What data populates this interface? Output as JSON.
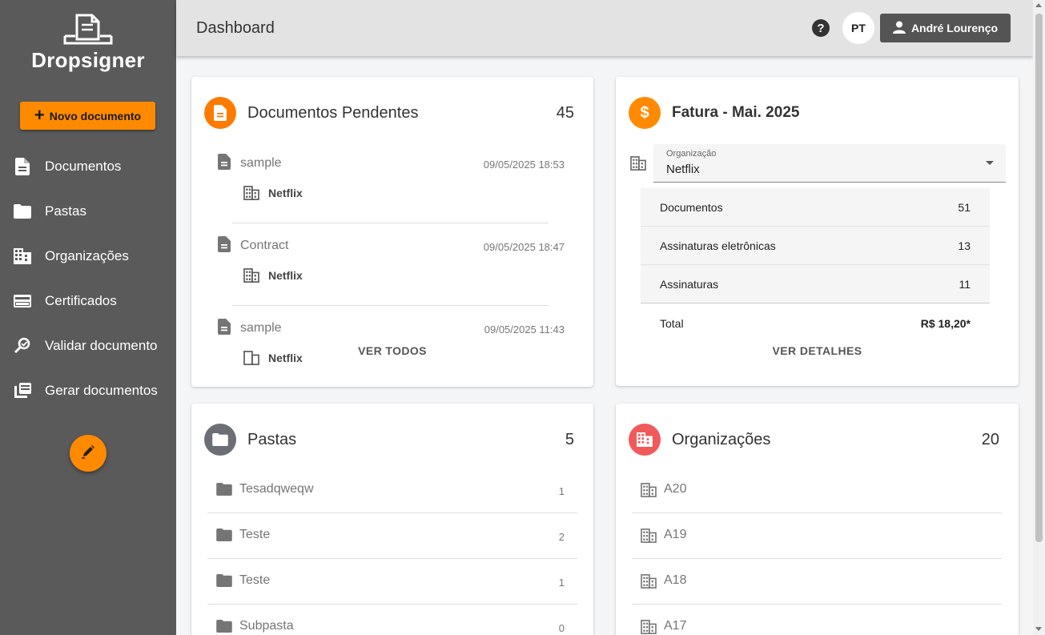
{
  "app": {
    "name": "Dropsigner"
  },
  "sidebar": {
    "new_document_label": "Novo documento",
    "items": [
      {
        "label": "Documentos",
        "icon": "document-icon"
      },
      {
        "label": "Pastas",
        "icon": "folder-icon"
      },
      {
        "label": "Organizações",
        "icon": "building-icon"
      },
      {
        "label": "Certificados",
        "icon": "credit-card-icon"
      },
      {
        "label": "Validar documento",
        "icon": "search-check-icon"
      },
      {
        "label": "Gerar documentos",
        "icon": "copy-icon"
      }
    ],
    "fab_icon": "pen-icon"
  },
  "header": {
    "title": "Dashboard",
    "language": "PT",
    "user_name": "André Lourenço"
  },
  "pending": {
    "title": "Documentos Pendentes",
    "count": "45",
    "items": [
      {
        "name": "sample",
        "date": "09/05/2025 18:53",
        "org": "Netflix"
      },
      {
        "name": "Contract",
        "date": "09/05/2025 18:47",
        "org": "Netflix"
      },
      {
        "name": "sample",
        "date": "09/05/2025 11:43",
        "org": "Netflix"
      }
    ],
    "view_all": "VER TODOS"
  },
  "invoice": {
    "title": "Fatura - Mai. 2025",
    "org_label": "Organização",
    "org_value": "Netflix",
    "rows": [
      {
        "label": "Documentos",
        "value": "51"
      },
      {
        "label": "Assinaturas eletrônicas",
        "value": "13"
      },
      {
        "label": "Assinaturas",
        "value": "11"
      }
    ],
    "total_label": "Total",
    "total_value": "R$ 18,20*",
    "details": "VER DETALHES"
  },
  "folders": {
    "title": "Pastas",
    "count": "5",
    "items": [
      {
        "name": "Tesadqweqw",
        "count": "1"
      },
      {
        "name": "Teste",
        "count": "2"
      },
      {
        "name": "Teste",
        "count": "1"
      },
      {
        "name": "Subpasta",
        "count": "0"
      }
    ]
  },
  "orgs": {
    "title": "Organizações",
    "count": "20",
    "items": [
      {
        "name": "A20"
      },
      {
        "name": "A19"
      },
      {
        "name": "A18"
      },
      {
        "name": "A17"
      }
    ]
  },
  "colors": {
    "sidebar": "#5a5a5a",
    "accent": "#ff8a00",
    "folder_icon_bg": "#6b6f75",
    "org_icon_bg": "#f05a5a"
  }
}
